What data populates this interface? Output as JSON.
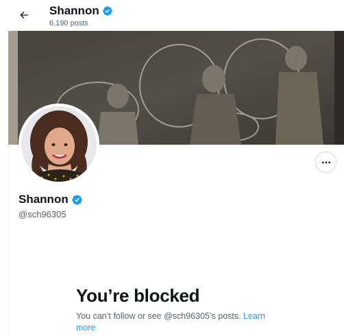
{
  "header": {
    "name": "Shannon",
    "post_count": "6,190 posts"
  },
  "profile": {
    "name": "Shannon",
    "handle": "@sch96305",
    "verified": true
  },
  "blocked": {
    "title": "You’re blocked",
    "message": "You can’t follow or see @sch96305’s posts.",
    "link_label": "Learn more"
  },
  "icons": {
    "back": "arrow-left-icon",
    "verified": "verified-badge-icon",
    "more": "more-horizontal-icon"
  },
  "colors": {
    "accent": "#1d9bf0",
    "text_primary": "#0f1419",
    "text_secondary": "#536471"
  }
}
